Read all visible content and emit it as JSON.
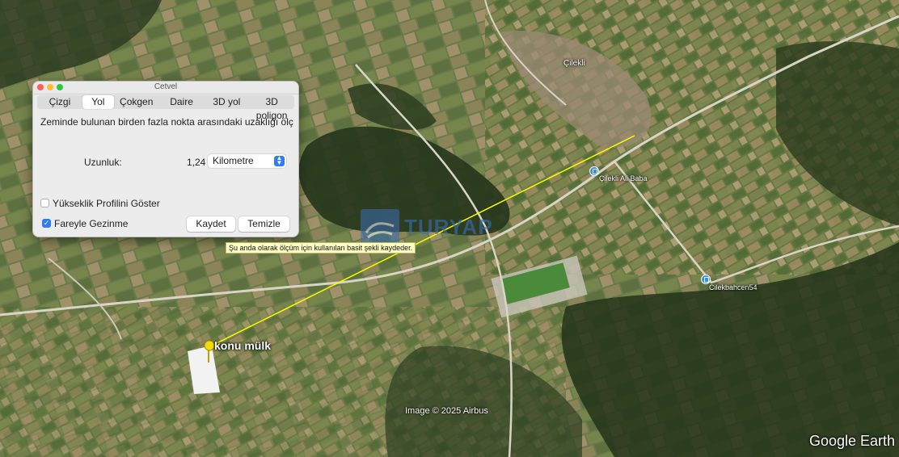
{
  "ruler_window": {
    "title": "Cetvel",
    "tabs": [
      "Çizgi",
      "Yol",
      "Çokgen",
      "Daire",
      "3D yol",
      "3D poligon"
    ],
    "selected_tab": "Yol",
    "description": "Zeminde bulunan birden fazla nokta arasındaki uzaklığı ölç",
    "length_label": "Uzunluk:",
    "length_value": "1,24",
    "unit_selected": "Kilometre",
    "show_elevation_profile": {
      "label": "Yükseklik Profilini Göster",
      "checked": false
    },
    "mouse_navigation": {
      "label": "Fareyle Gezinme",
      "checked": true
    },
    "save_button": "Kaydet",
    "clear_button": "Temizle"
  },
  "tooltip": "Şu anda olarak ölçüm için kullanılan basit şekli kaydeder.",
  "map": {
    "places": {
      "village": "Çilekli",
      "poi_1": "Çilekli Ali Baba",
      "poi_2": "Cilekbahcen54"
    },
    "placemark_label": "konu mülk",
    "path_color": "#ffff00",
    "pin_color": "#f5d90a",
    "watermark": "TURYAP"
  },
  "credit": "Image © 2025 Airbus",
  "logo": "Google Earth"
}
